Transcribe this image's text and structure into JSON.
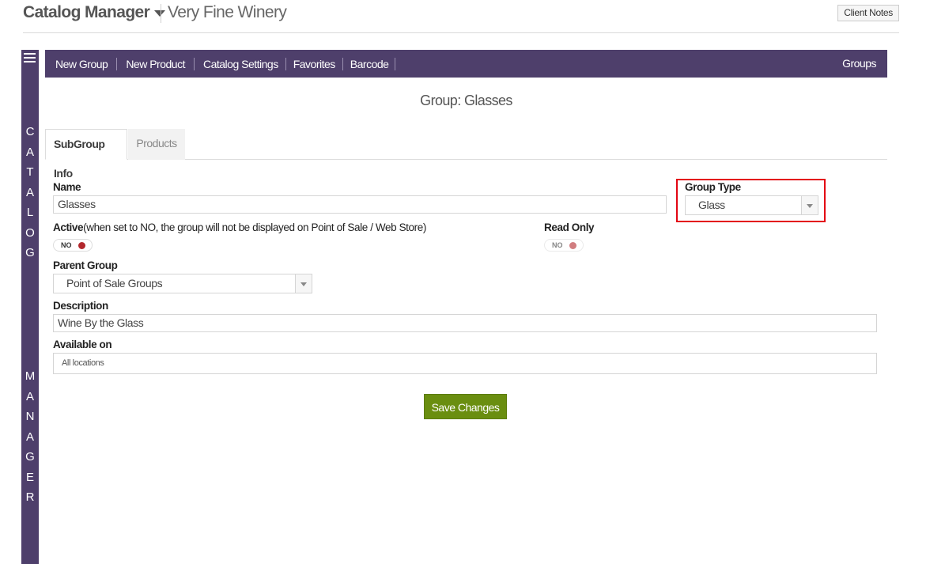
{
  "header": {
    "app_title": "Catalog Manager",
    "winery": "Very Fine Winery",
    "client_notes": "Client Notes"
  },
  "sidebar": {
    "word1": [
      "C",
      "A",
      "T",
      "A",
      "L",
      "O",
      "G"
    ],
    "word2": [
      "M",
      "A",
      "N",
      "A",
      "G",
      "E",
      "R"
    ]
  },
  "nav": {
    "items": [
      "New Group",
      "New Product",
      "Catalog Settings",
      "Favorites",
      "Barcode"
    ],
    "right": "Groups"
  },
  "page_title": "Group: Glasses",
  "tabs": {
    "active": "SubGroup Info",
    "inactive": "Products"
  },
  "form": {
    "name_label": "Name",
    "name_value": "Glasses",
    "group_type_label": "Group Type",
    "group_type_value": "Glass",
    "active_label": "Active",
    "active_note": "(when set to NO, the group will not be displayed on Point of Sale / Web Store)",
    "active_toggle": "NO",
    "read_only_label": "Read Only",
    "read_only_toggle": "NO",
    "parent_group_label": "Parent Group",
    "parent_group_value": "Point of Sale Groups",
    "description_label": "Description",
    "description_value": "Wine By the Glass",
    "available_on_label": "Available on",
    "available_on_value": "All locations",
    "save_label": "Save Changes"
  },
  "colors": {
    "brand_purple": "#4e3f6b",
    "save_green": "#6a8e10",
    "highlight_red": "#e30613",
    "toggle_dot": "#b3282d"
  }
}
